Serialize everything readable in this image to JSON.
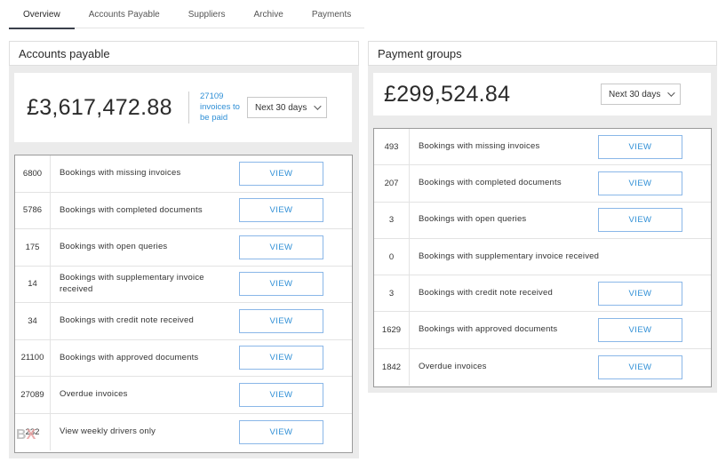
{
  "tabs": [
    {
      "label": "Overview",
      "active": true
    },
    {
      "label": "Accounts Payable",
      "active": false
    },
    {
      "label": "Suppliers",
      "active": false
    },
    {
      "label": "Archive",
      "active": false
    },
    {
      "label": "Payments",
      "active": false
    }
  ],
  "accounts_payable": {
    "title": "Accounts payable",
    "amount": "£3,617,472.88",
    "invoices_link": "27109 invoices to be paid",
    "period": "Next 30 days",
    "rows": [
      {
        "count": "6800",
        "label": "Bookings with missing invoices",
        "button": "VIEW"
      },
      {
        "count": "5786",
        "label": "Bookings with completed documents",
        "button": "VIEW"
      },
      {
        "count": "175",
        "label": "Bookings with open queries",
        "button": "VIEW"
      },
      {
        "count": "14",
        "label": "Bookings with supplementary invoice received",
        "button": "VIEW"
      },
      {
        "count": "34",
        "label": "Bookings with credit note received",
        "button": "VIEW"
      },
      {
        "count": "21100",
        "label": "Bookings with approved documents",
        "button": "VIEW"
      },
      {
        "count": "27089",
        "label": "Overdue invoices",
        "button": "VIEW"
      },
      {
        "count": "232",
        "label": "View weekly drivers only",
        "button": "VIEW"
      }
    ]
  },
  "payment_groups": {
    "title": "Payment groups",
    "amount": "£299,524.84",
    "period": "Next 30 days",
    "rows": [
      {
        "count": "493",
        "label": "Bookings with missing invoices",
        "button": "VIEW"
      },
      {
        "count": "207",
        "label": "Bookings with completed documents",
        "button": "VIEW"
      },
      {
        "count": "3",
        "label": "Bookings with open queries",
        "button": "VIEW"
      },
      {
        "count": "0",
        "label": "Bookings with supplementary invoice received",
        "button": ""
      },
      {
        "count": "3",
        "label": "Bookings with credit note received",
        "button": "VIEW"
      },
      {
        "count": "1629",
        "label": "Bookings with approved documents",
        "button": "VIEW"
      },
      {
        "count": "1842",
        "label": "Overdue invoices",
        "button": "VIEW"
      }
    ]
  },
  "watermark": "BX"
}
